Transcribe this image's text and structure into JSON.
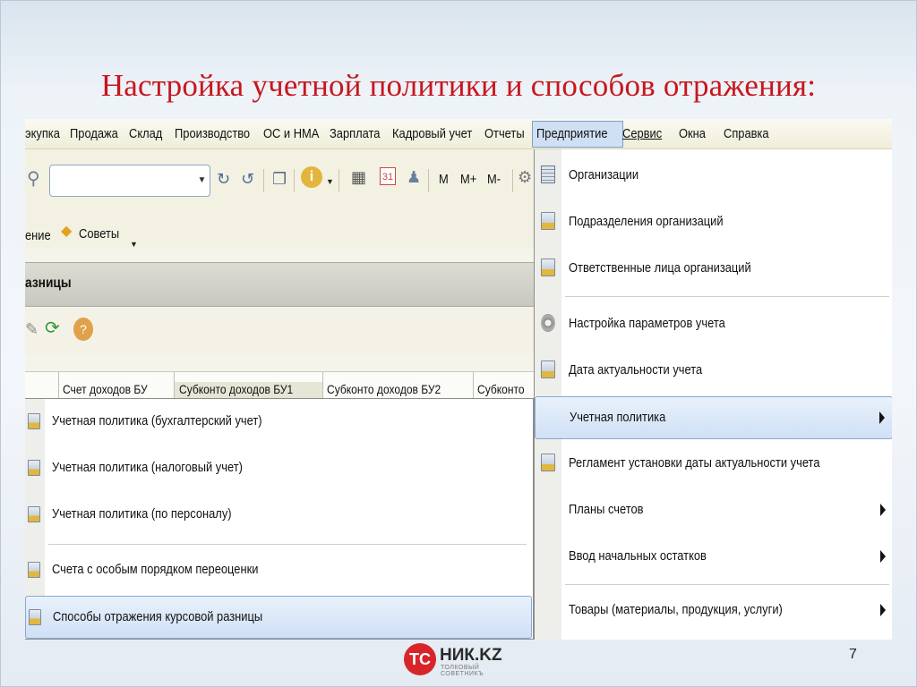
{
  "slide": {
    "title": "Настройка учетной политики и способов отражения:",
    "page_number": "7"
  },
  "logo": {
    "mark": "ТС",
    "name": "НИК.KZ",
    "tagline": "ТОЛКОВЫЙ СОВЕТНИКЪ"
  },
  "menubar": {
    "items": [
      "экупка",
      "Продажа",
      "Склад",
      "Производство",
      "ОС и НМА",
      "Зарплата",
      "Кадровый учет",
      "Отчеты",
      "Предприятие",
      "Сервис",
      "Окна",
      "Справка"
    ],
    "active": "Предприятие"
  },
  "toolbar": {
    "search_value": "",
    "buttons": [
      "M",
      "M+",
      "M-"
    ],
    "partial_label": "ение",
    "tips_label": "Советы"
  },
  "section": {
    "title": "азницы"
  },
  "table": {
    "columns": [
      "Счет доходов БУ",
      "Субконто доходов БУ1",
      "Субконто доходов БУ2",
      "Субконто"
    ]
  },
  "submenu": {
    "items": [
      "Учетная политика (бухгалтерский учет)",
      "Учетная политика (налоговый учет)",
      "Учетная политика (по персоналу)",
      "Счета с особым порядком переоценки",
      "Способы отражения курсовой разницы"
    ],
    "highlighted": "Способы отражения курсовой разницы"
  },
  "dropdown": {
    "items": [
      {
        "label": "Организации",
        "icon": "building-icon",
        "submenu": false
      },
      {
        "label": "Подразделения организаций",
        "icon": "document-icon",
        "submenu": false
      },
      {
        "label": "Ответственные лица организаций",
        "icon": "document-icon",
        "submenu": false
      },
      {
        "label": "Настройка параметров учета",
        "icon": "gear-icon",
        "submenu": false
      },
      {
        "label": "Дата актуальности учета",
        "icon": "document-icon",
        "submenu": false
      },
      {
        "label": "Учетная политика",
        "icon": "",
        "submenu": true
      },
      {
        "label": "Регламент установки даты актуальности учета",
        "icon": "document-icon",
        "submenu": false
      },
      {
        "label": "Планы счетов",
        "icon": "",
        "submenu": true
      },
      {
        "label": "Ввод начальных остатков",
        "icon": "",
        "submenu": true
      },
      {
        "label": "Товары (материалы, продукция, услуги)",
        "icon": "",
        "submenu": true
      }
    ],
    "highlighted": "Учетная политика"
  }
}
